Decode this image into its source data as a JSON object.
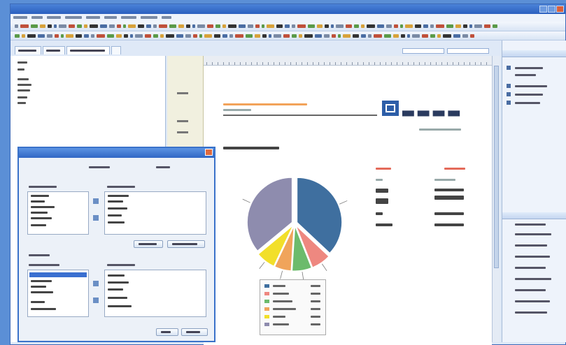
{
  "colors": {
    "accent": "#2f66c4",
    "chart_blue": "#3f6f9f",
    "chart_gray": "#8e8cae",
    "chart_yellow": "#f2df2a",
    "chart_orange": "#f0a45b",
    "chart_green": "#6cbb6c",
    "chart_pink": "#ee8880",
    "header_orange": "#f2a35a"
  },
  "icons": [
    "close-icon",
    "logo-icon",
    "pie-chart",
    "arrow-right-icon",
    "arrow-left-icon"
  ],
  "report": {
    "logo_text": "—"
  },
  "chart_data": {
    "type": "pie",
    "title": "",
    "slices": [
      {
        "name": "",
        "value": 37,
        "color": "#3f6f9f"
      },
      {
        "name": "",
        "value": 7,
        "color": "#ee8880"
      },
      {
        "name": "",
        "value": 7,
        "color": "#6cbb6c"
      },
      {
        "name": "",
        "value": 6,
        "color": "#f0a45b"
      },
      {
        "name": "",
        "value": 7,
        "color": "#f2df2a"
      },
      {
        "name": "",
        "value": 36,
        "color": "#8e8cae"
      }
    ],
    "legend": "below"
  }
}
